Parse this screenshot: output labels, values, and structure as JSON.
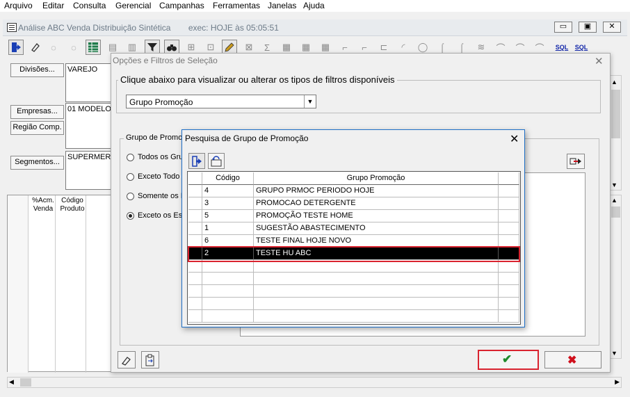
{
  "menu": [
    "Arquivo",
    "Editar",
    "Consulta",
    "Gerencial",
    "Campanhas",
    "Ferramentas",
    "Janelas",
    "Ajuda"
  ],
  "mdi": {
    "title": "Análise ABC Venda Distribuição Sintética",
    "exec": "exec: HOJE às 05:05:51",
    "min": "▭",
    "restore": "▣",
    "close": "✕"
  },
  "toolbar": {
    "sql_label": "SQL"
  },
  "side": {
    "divisoes_btn": "Divisões...",
    "divisoes_value": "VAREJO",
    "empresas_btn": "Empresas...",
    "empresas_value": "01 MODELO",
    "regiao_btn": "Região Comp.",
    "segmentos_btn": "Segmentos...",
    "segmentos_value": "SUPERMER"
  },
  "bgtable": {
    "col1": "%Acm. Venda",
    "col2": "Código Produto"
  },
  "dialog": {
    "title": "Opções e Filtros de Seleção",
    "close": "✕",
    "group_label": "Clique abaixo para visualizar ou alterar os tipos de filtros disponíveis",
    "combo_value": "Grupo Promoção",
    "filter_group_label": "Grupo de Promoç",
    "radios": [
      "Todos os Gru",
      "Exceto Todo",
      "Somente os I",
      "Exceto os Es"
    ],
    "selected_radio": 3,
    "ok_glyph": "✔",
    "cancel_glyph": "✖"
  },
  "sub": {
    "title": "Pesquisa de Grupo de Promoção",
    "close": "✕",
    "columns": [
      "Código",
      "Grupo Promoção"
    ],
    "rows": [
      {
        "codigo": "4",
        "grupo": "GRUPO PRMOC PERIODO HOJE"
      },
      {
        "codigo": "3",
        "grupo": "PROMOCAO DETERGENTE"
      },
      {
        "codigo": "5",
        "grupo": "PROMOÇÃO TESTE HOME"
      },
      {
        "codigo": "1",
        "grupo": "SUGESTÃO ABASTECIMENTO"
      },
      {
        "codigo": "6",
        "grupo": "TESTE FINAL HOJE NOVO"
      },
      {
        "codigo": "2",
        "grupo": "TESTE HU ABC"
      }
    ],
    "selected_row": 5
  },
  "colors": {
    "selection": "#000000",
    "highlight": "#d9232f",
    "ok": "#1e8a2b",
    "cancel": "#d0101c",
    "title_text": "#6d7b88"
  }
}
